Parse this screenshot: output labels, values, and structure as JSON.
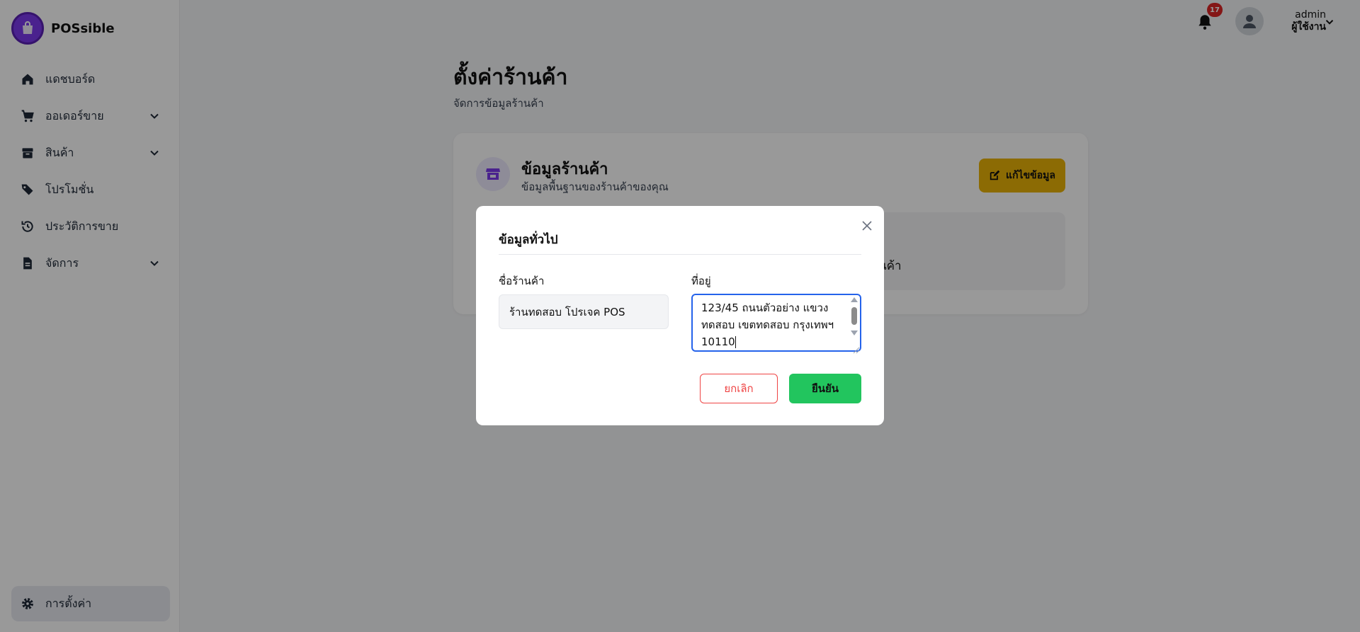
{
  "brand": {
    "name": "POSsible",
    "logo_icon": "shopping-bag-icon"
  },
  "sidebar": {
    "items": [
      {
        "label": "แดชบอร์ด",
        "icon": "home-icon",
        "has_submenu": false
      },
      {
        "label": "ออเดอร์ขาย",
        "icon": "cart-icon",
        "has_submenu": true
      },
      {
        "label": "สินค้า",
        "icon": "box-icon",
        "has_submenu": true
      },
      {
        "label": "โปรโมชั่น",
        "icon": "tags-icon",
        "has_submenu": false
      },
      {
        "label": "ประวัติการขาย",
        "icon": "history-icon",
        "has_submenu": false
      },
      {
        "label": "จัดการ",
        "icon": "file-icon",
        "has_submenu": true
      }
    ],
    "settings": {
      "label": "การตั้งค่า",
      "icon": "gear-icon",
      "active": true
    }
  },
  "topbar": {
    "notification_count": "17",
    "user_name": "admin",
    "user_role": "ผู้ใช้งาน"
  },
  "page": {
    "title": "ตั้งค่าร้านค้า",
    "subtitle": "จัดการข้อมูลร้านค้า"
  },
  "store_card": {
    "title": "ข้อมูลร้านค้า",
    "subtitle": "ข้อมูลพื้นฐานของร้านค้าของคุณ",
    "edit_label": "แก้ไขข้อมูล",
    "partial_text": "นค้า"
  },
  "modal": {
    "title": "ข้อมูลทั่วไป",
    "store_name_label": "ชื่อร้านค้า",
    "store_name_value": "ร้านทดสอบ โปรเจค POS",
    "address_label": "ที่อยู่",
    "address_lines": [
      "123/45 ถนนตัวอย่าง แขวง",
      "ทดสอบ เขตทดสอบ กรุงเทพฯ",
      "10110"
    ],
    "cancel_label": "ยกเลิก",
    "confirm_label": "ยืนยัน"
  },
  "colors": {
    "brand_purple": "#7c3aed",
    "edit_yellow": "#eab308",
    "confirm_green": "#22c55e",
    "cancel_red": "#ef4444",
    "focus_blue": "#2563eb",
    "badge_red": "#dc2626"
  }
}
